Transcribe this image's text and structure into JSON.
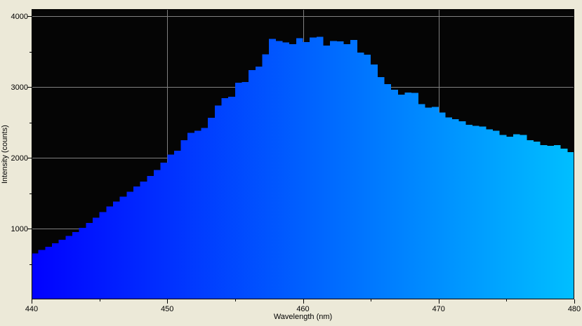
{
  "window": {
    "frame_background": "#ece9d8"
  },
  "chart_data": {
    "type": "area",
    "style": "step-histogram-filled",
    "xlabel": "Wavelength (nm)",
    "ylabel": "Intensity (counts)",
    "xlim": [
      440,
      480
    ],
    "ylim": [
      0,
      4100
    ],
    "x_major_ticks": [
      440,
      450,
      460,
      470,
      480
    ],
    "x_minor_ticks": [
      445,
      455,
      465,
      475
    ],
    "y_major_ticks": [
      1000,
      2000,
      3000,
      4000
    ],
    "y_minor_ticks": [
      500,
      1500,
      2500,
      3500
    ],
    "grid": true,
    "legend": "none",
    "colors": {
      "plot_background": "#050505",
      "grid": "#808080",
      "axis": "#000000",
      "text": "#000000",
      "fill_gradient_left": "#0101ff",
      "fill_gradient_right": "#00bfff"
    },
    "x": [
      440,
      440.5,
      441,
      441.5,
      442,
      442.5,
      443,
      443.5,
      444,
      444.5,
      445,
      445.5,
      446,
      446.5,
      447,
      447.5,
      448,
      448.5,
      449,
      449.5,
      450,
      450.5,
      451,
      451.5,
      452,
      452.5,
      453,
      453.5,
      454,
      454.5,
      455,
      455.5,
      456,
      456.5,
      457,
      457.5,
      458,
      458.5,
      459,
      459.5,
      460,
      460.5,
      461,
      461.5,
      462,
      462.5,
      463,
      463.5,
      464,
      464.5,
      465,
      465.5,
      466,
      466.5,
      467,
      467.5,
      468,
      468.5,
      469,
      469.5,
      470,
      470.5,
      471,
      471.5,
      472,
      472.5,
      473,
      473.5,
      474,
      474.5,
      475,
      475.5,
      476,
      476.5,
      477,
      477.5,
      478,
      478.5,
      479,
      479.5,
      480
    ],
    "values": [
      650,
      700,
      745,
      790,
      840,
      895,
      950,
      1010,
      1080,
      1155,
      1235,
      1310,
      1380,
      1450,
      1520,
      1595,
      1665,
      1745,
      1825,
      1930,
      2045,
      2100,
      2250,
      2350,
      2380,
      2420,
      2565,
      2740,
      2840,
      2860,
      3060,
      3070,
      3240,
      3290,
      3460,
      3680,
      3650,
      3630,
      3605,
      3690,
      3635,
      3700,
      3710,
      3585,
      3650,
      3645,
      3605,
      3665,
      3485,
      3455,
      3320,
      3140,
      3040,
      2960,
      2890,
      2920,
      2915,
      2760,
      2710,
      2720,
      2640,
      2570,
      2545,
      2515,
      2465,
      2450,
      2440,
      2400,
      2380,
      2320,
      2300,
      2330,
      2320,
      2250,
      2230,
      2180,
      2170,
      2180,
      2130,
      2080,
      2070
    ]
  }
}
